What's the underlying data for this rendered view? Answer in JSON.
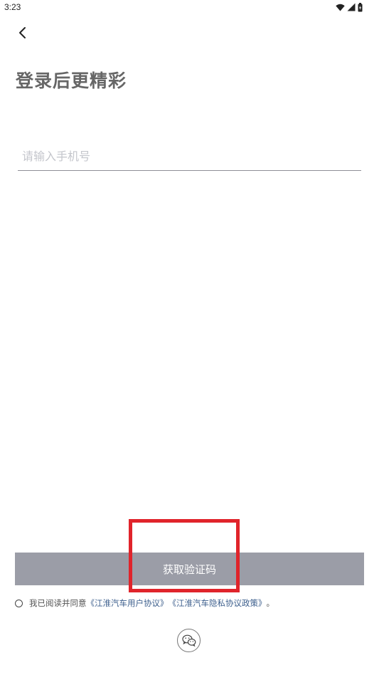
{
  "status_bar": {
    "time": "3:23",
    "icons": [
      "wifi-icon",
      "signal-icon",
      "battery-icon"
    ]
  },
  "header": {
    "back_icon": "chevron-left-icon"
  },
  "main": {
    "title": "登录后更精彩",
    "phone_input": {
      "value": "",
      "placeholder": "请输入手机号"
    },
    "get_code_button": "获取验证码"
  },
  "agreement": {
    "prefix": "我已阅读并同意",
    "user_agreement": "《江淮汽车用户协议》",
    "privacy_policy": "《江淮汽车隐私协议政策》",
    "suffix": "。",
    "checked": false
  },
  "social_login": {
    "icon": "wechat-icon"
  },
  "colors": {
    "button_bg": "#9b9da7",
    "link": "#3d5f8d",
    "highlight": "#e0242b"
  }
}
